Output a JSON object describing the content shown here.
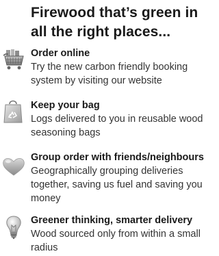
{
  "heading": "Firewood that’s green in all the right places...",
  "features": [
    {
      "icon": "shopping-basket-icon",
      "title": "Order online",
      "description": "Try the new carbon friendly booking system by visiting our website"
    },
    {
      "icon": "recycle-bag-icon",
      "title": "Keep your bag",
      "description": "Logs delivered to you in reusable wood seasoning bags"
    },
    {
      "icon": "heart-icon",
      "title": "Group order with friends/neighbours",
      "description": "Geographically grouping deliveries together, saving us fuel and saving you money"
    },
    {
      "icon": "light-bulb-icon",
      "title": "Greener thinking, smarter delivery",
      "description": "Wood sourced only from within a small radius"
    }
  ]
}
